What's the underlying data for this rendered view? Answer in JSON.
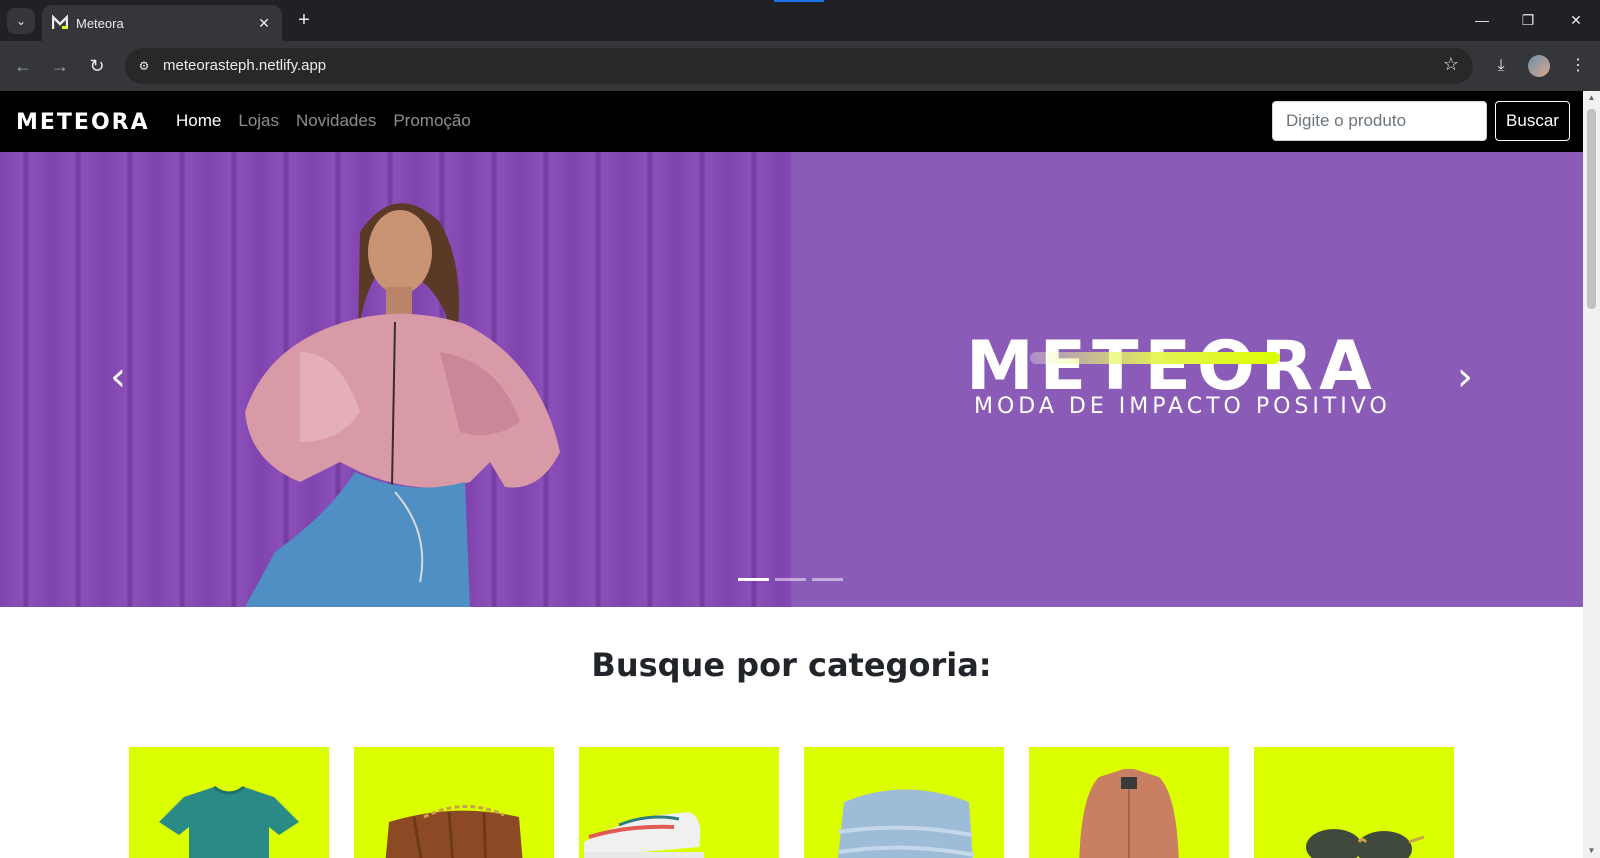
{
  "browser": {
    "tab_title": "Meteora",
    "url": "meteorasteph.netlify.app",
    "icons": [
      "tab-search-icon",
      "meteora-favicon-icon",
      "close-tab-icon",
      "new-tab-icon",
      "minimize-icon",
      "restore-icon",
      "close-window-icon",
      "back-icon",
      "forward-icon",
      "reload-icon",
      "site-settings-icon",
      "bookmark-star-icon",
      "download-icon",
      "profile-avatar-icon",
      "menu-icon"
    ]
  },
  "site": {
    "brand": "METEORA",
    "nav": {
      "home": "Home",
      "stores": "Lojas",
      "news": "Novidades",
      "promo": "Promoção"
    },
    "search_placeholder": "Digite o produto",
    "search_button": "Buscar"
  },
  "hero": {
    "logo_text": "METEORA",
    "tagline": "MODA DE IMPACTO POSITIVO",
    "slides_total": 3,
    "slide_active": 1
  },
  "categories": {
    "title": "Busque por categoria:",
    "items": [
      "t-shirt",
      "bag",
      "sneakers",
      "jeans",
      "jacket",
      "sunglasses"
    ],
    "tile_color": "#dcff00"
  },
  "colors": {
    "accent": "#dcff00",
    "hero_bg": "#8a5bb7",
    "nav_bg": "#000000"
  }
}
